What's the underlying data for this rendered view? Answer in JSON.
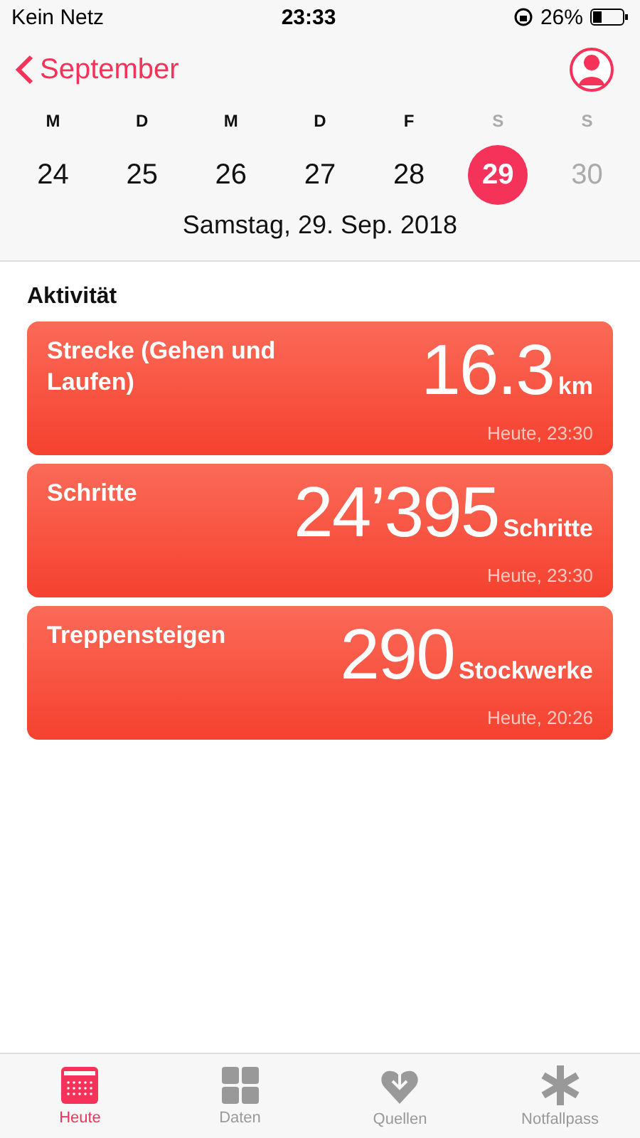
{
  "status_bar": {
    "carrier": "Kein Netz",
    "time": "23:33",
    "battery": "26%"
  },
  "nav": {
    "back": "September"
  },
  "week": [
    {
      "letter": "M",
      "number": "24",
      "weekend": false,
      "selected": false,
      "future": false
    },
    {
      "letter": "D",
      "number": "25",
      "weekend": false,
      "selected": false,
      "future": false
    },
    {
      "letter": "M",
      "number": "26",
      "weekend": false,
      "selected": false,
      "future": false
    },
    {
      "letter": "D",
      "number": "27",
      "weekend": false,
      "selected": false,
      "future": false
    },
    {
      "letter": "F",
      "number": "28",
      "weekend": false,
      "selected": false,
      "future": false
    },
    {
      "letter": "S",
      "number": "29",
      "weekend": true,
      "selected": true,
      "future": false
    },
    {
      "letter": "S",
      "number": "30",
      "weekend": true,
      "selected": false,
      "future": true
    }
  ],
  "date": "Samstag, 29. Sep. 2018",
  "section": "Aktivität",
  "cards": [
    {
      "title": "Strecke (Gehen und Laufen)",
      "value": "16.3",
      "unit": "km",
      "time": "Heute, 23:30"
    },
    {
      "title": "Schritte",
      "value": "24’395",
      "unit": "Schritte",
      "time": "Heute, 23:30"
    },
    {
      "title": "Treppensteigen",
      "value": "290",
      "unit": "Stockwerke",
      "time": "Heute, 20:26"
    }
  ],
  "tabs": [
    {
      "kind": "calendar",
      "label": "Heute",
      "selected": true
    },
    {
      "kind": "grid",
      "label": "Daten",
      "selected": false
    },
    {
      "kind": "heart",
      "label": "Quellen",
      "selected": false
    },
    {
      "kind": "asterisk",
      "label": "Notfallpass",
      "selected": false
    }
  ]
}
